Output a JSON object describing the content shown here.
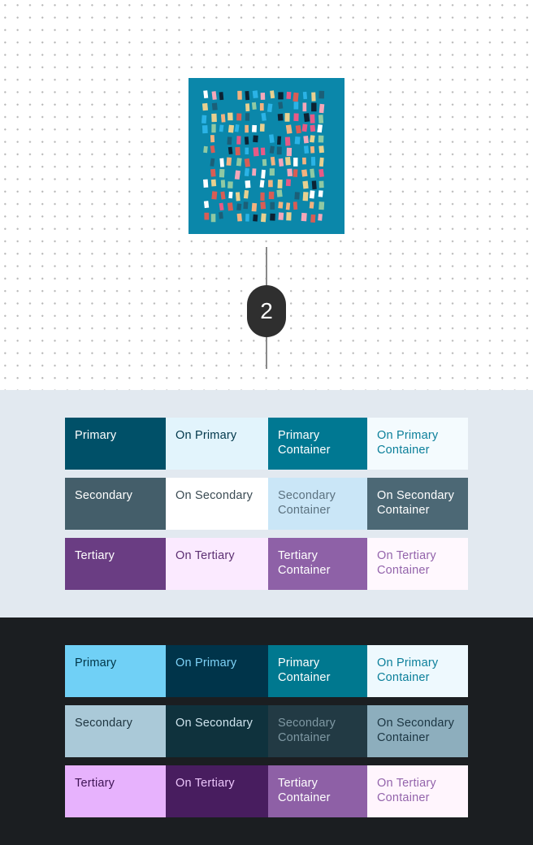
{
  "diagram": {
    "step_number": "2",
    "artwork_colors": {
      "background": "#0b87aa",
      "marks": [
        "#e8d08f",
        "#f2b27f",
        "#e75a86",
        "#2bb3e6",
        "#0c2233",
        "#ffffff",
        "#f4a7b9",
        "#8fc9a3",
        "#1b5f78",
        "#d85d55"
      ]
    }
  },
  "light_scheme": {
    "background": "#e2e9f0",
    "rows": [
      [
        {
          "label": "Primary",
          "bg": "#005068",
          "fg": "#ffffff"
        },
        {
          "label": "On Primary",
          "bg": "#e2f4fc",
          "fg": "#00374a"
        },
        {
          "label": "Primary Container",
          "bg": "#007892",
          "fg": "#ffffff"
        },
        {
          "label": "On Primary Container",
          "bg": "#f4fbfe",
          "fg": "#0b7f9a"
        }
      ],
      [
        {
          "label": "Secondary",
          "bg": "#445e6a",
          "fg": "#ffffff"
        },
        {
          "label": "On Secondary",
          "bg": "#ffffff",
          "fg": "#3b4b53"
        },
        {
          "label": "Secondary Container",
          "bg": "#cae6f7",
          "fg": "#5c7280"
        },
        {
          "label": "On Secondary Container",
          "bg": "#4c6875",
          "fg": "#ffffff"
        }
      ],
      [
        {
          "label": "Tertiary",
          "bg": "#6a3d83",
          "fg": "#ffffff"
        },
        {
          "label": "On Tertiary",
          "bg": "#fbeaff",
          "fg": "#5c2f72"
        },
        {
          "label": "Tertiary Container",
          "bg": "#8e61a7",
          "fg": "#ffffff"
        },
        {
          "label": "On Tertiary Container",
          "bg": "#fff8fe",
          "fg": "#9364ab"
        }
      ]
    ]
  },
  "dark_scheme": {
    "background": "#1b1e21",
    "rows": [
      [
        {
          "label": "Primary",
          "bg": "#70d0f6",
          "fg": "#003547"
        },
        {
          "label": "On Primary",
          "bg": "#00344a",
          "fg": "#7fd3f7"
        },
        {
          "label": "Primary Container",
          "bg": "#00788f",
          "fg": "#ffffff"
        },
        {
          "label": "On Primary Container",
          "bg": "#eef9fe",
          "fg": "#0b7f9a"
        }
      ],
      [
        {
          "label": "Secondary",
          "bg": "#aac9d8",
          "fg": "#1e3540"
        },
        {
          "label": "On Secondary",
          "bg": "#0f323d",
          "fg": "#cfe4ee"
        },
        {
          "label": "Secondary Container",
          "bg": "#223a44",
          "fg": "#7f98a3"
        },
        {
          "label": "On Secondary Container",
          "bg": "#8daebd",
          "fg": "#1b3542"
        }
      ],
      [
        {
          "label": "Tertiary",
          "bg": "#e7b2fd",
          "fg": "#3e1454"
        },
        {
          "label": "On Tertiary",
          "bg": "#481d5f",
          "fg": "#ecc6fb"
        },
        {
          "label": "Tertiary Container",
          "bg": "#8e60a6",
          "fg": "#ffffff"
        },
        {
          "label": "On Tertiary Container",
          "bg": "#fff5fd",
          "fg": "#9364ab"
        }
      ]
    ]
  }
}
